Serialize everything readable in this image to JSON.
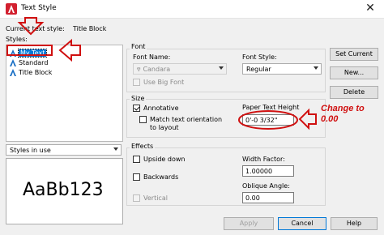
{
  "window": {
    "title": "Text Style",
    "close_glyph": "✕"
  },
  "current_style": {
    "label": "Current text style:",
    "value": "Title Block"
  },
  "styles": {
    "label": "Styles:",
    "items": [
      {
        "label": "My Text",
        "selected": true
      },
      {
        "label": "Standard",
        "selected": false
      },
      {
        "label": "Title Block",
        "selected": false
      }
    ],
    "filter_value": "Styles in use"
  },
  "preview": {
    "text": "AaBb123"
  },
  "font": {
    "group_label": "Font",
    "font_name_label": "Font Name:",
    "font_name_value": "Candara",
    "font_name_icon": "truetype-icon",
    "font_style_label": "Font Style:",
    "font_style_value": "Regular",
    "use_big_font_label": "Use Big Font"
  },
  "size": {
    "group_label": "Size",
    "annotative_label": "Annotative",
    "match_orientation_label": "Match text orientation to layout",
    "paper_height_label": "Paper Text Height",
    "paper_height_value": "0'-0 3/32\""
  },
  "effects": {
    "group_label": "Effects",
    "upside_down_label": "Upside down",
    "backwards_label": "Backwards",
    "vertical_label": "Vertical",
    "width_factor_label": "Width Factor:",
    "width_factor_value": "1.00000",
    "oblique_label": "Oblique Angle:",
    "oblique_value": "0.00"
  },
  "buttons": {
    "set_current": "Set Current",
    "new": "New...",
    "delete": "Delete",
    "apply": "Apply",
    "cancel": "Cancel",
    "help": "Help"
  },
  "annotation": {
    "line1": "Change to",
    "line2": "0.00"
  },
  "colors": {
    "accent": "#0078d7",
    "annotation": "#d01010",
    "autocad_red": "#d2202f"
  }
}
